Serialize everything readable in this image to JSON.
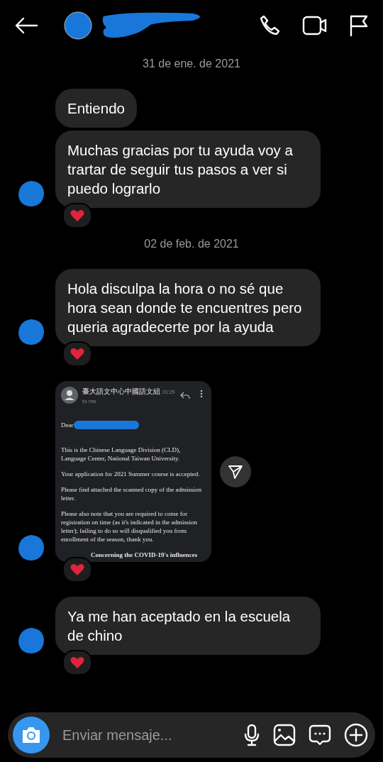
{
  "sections": [
    {
      "date": "31 de ene. de 2021",
      "messages": [
        {
          "kind": "text",
          "text": "Entiendo",
          "avatar": false,
          "reaction": false
        },
        {
          "kind": "text",
          "text": "Muchas gracias por tu ayuda voy a trartar de seguir tus pasos a ver si puedo lograrlo",
          "avatar": true,
          "reaction": true
        }
      ]
    },
    {
      "date": "02 de feb. de 2021",
      "messages": [
        {
          "kind": "text",
          "text": "Hola disculpa la hora o no sé que hora sean donde te encuentres pero queria agradecerte por la ayuda",
          "avatar": true,
          "reaction": true
        },
        {
          "kind": "email",
          "avatar": true,
          "reaction": true,
          "email": {
            "sender": "臺大語文中心中國語文組",
            "time": "01:29",
            "recipient": "to me",
            "greeting": "Dear",
            "paragraphs": [
              "This is the Chinese Language Division (CLD), Language Center, National Taiwan University.",
              "Your application for 2021 Summer course is accepted.",
              "Please find attached the scanned copy of the admission letter.",
              "Please also note that you are required to come for registration on time (as it's indicated in the admission letter); failing to do so will disqualified you from enrollment of the season, thank you."
            ],
            "last_line": "Concerning the COVID-19's influences"
          }
        },
        {
          "kind": "text",
          "text": "Ya me han aceptado en la escuela de chino",
          "avatar": true,
          "reaction": true
        }
      ]
    }
  ],
  "composer": {
    "placeholder": "Enviar mensaje..."
  }
}
